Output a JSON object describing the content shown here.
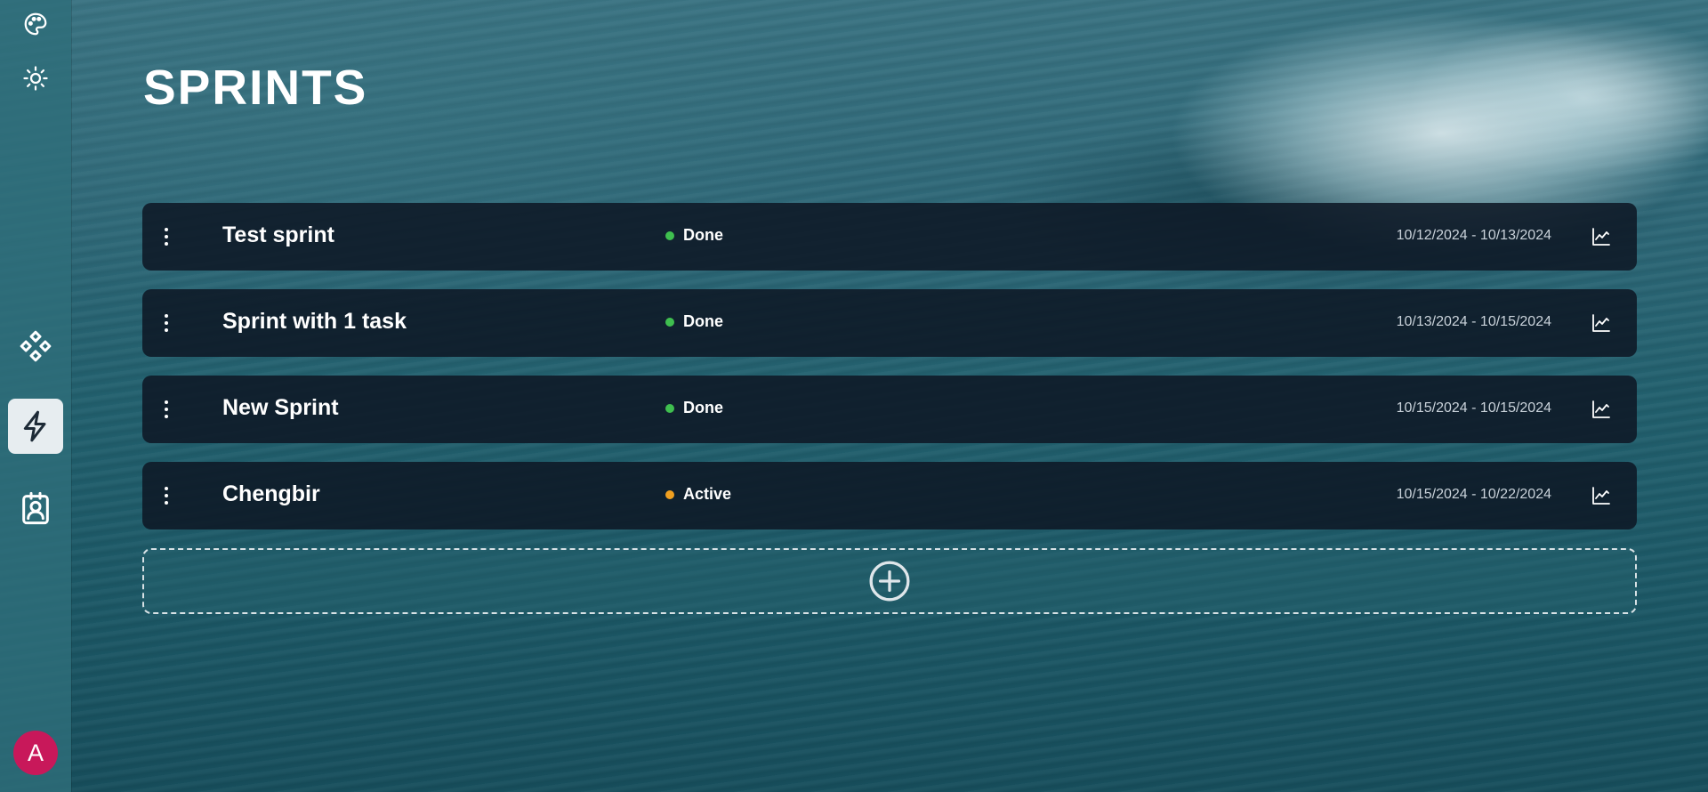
{
  "page": {
    "title": "SPRINTS"
  },
  "sidebar": {
    "top_icons": [
      {
        "icon": "palette-icon"
      },
      {
        "icon": "sun-icon"
      }
    ],
    "nav_icons": [
      {
        "icon": "components-icon",
        "active": false
      },
      {
        "icon": "lightning-icon",
        "active": true
      },
      {
        "icon": "contact-badge-icon",
        "active": false
      }
    ],
    "avatar": {
      "initial": "A",
      "color": "#c8185a"
    }
  },
  "sprints": [
    {
      "name": "Test sprint",
      "status": "Done",
      "status_color": "#3fbf4f",
      "dates": "10/12/2024 - 10/13/2024"
    },
    {
      "name": "Sprint with 1 task",
      "status": "Done",
      "status_color": "#3fbf4f",
      "dates": "10/13/2024 - 10/15/2024"
    },
    {
      "name": "New Sprint",
      "status": "Done",
      "status_color": "#3fbf4f",
      "dates": "10/15/2024 - 10/15/2024"
    },
    {
      "name": "Chengbir",
      "status": "Active",
      "status_color": "#f0a020",
      "dates": "10/15/2024 - 10/22/2024"
    }
  ],
  "add_sprint": {
    "icon": "add-circle-icon"
  }
}
